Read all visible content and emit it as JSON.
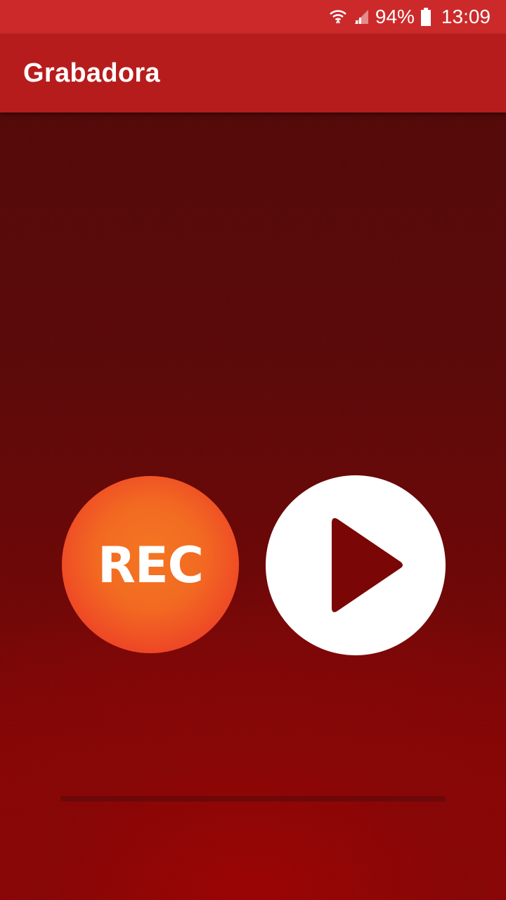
{
  "status_bar": {
    "wifi_icon": "wifi-icon",
    "signal_icon": "signal-icon",
    "battery_percent": "94%",
    "battery_icon": "battery-icon",
    "time": "13:09"
  },
  "app_bar": {
    "title": "Grabadora"
  },
  "controls": {
    "record_label": "REC",
    "record_icon": "record-icon",
    "play_icon": "play-icon"
  },
  "progress": {
    "value": 0
  },
  "colors": {
    "status_bar": "#cc2a2a",
    "app_bar": "#b71c1c",
    "background_top": "#580a0a",
    "background_bottom": "#9e0404",
    "record_center": "#f47621",
    "record_edge": "#e8262a",
    "play_button": "#ffffff",
    "play_triangle": "#7a0606"
  }
}
